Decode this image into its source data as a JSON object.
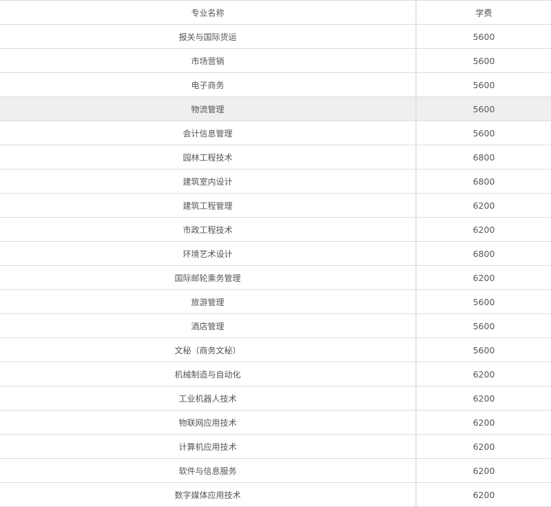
{
  "table": {
    "headers": {
      "major": "专业名称",
      "fee": "学费"
    },
    "highlighted_row": 3,
    "rows": [
      {
        "major": "报关与国际货运",
        "fee": "5600"
      },
      {
        "major": "市场营销",
        "fee": "5600"
      },
      {
        "major": "电子商务",
        "fee": "5600"
      },
      {
        "major": "物流管理",
        "fee": "5600"
      },
      {
        "major": "会计信息管理",
        "fee": "5600"
      },
      {
        "major": "园林工程技术",
        "fee": "6800"
      },
      {
        "major": "建筑室内设计",
        "fee": "6800"
      },
      {
        "major": "建筑工程管理",
        "fee": "6200"
      },
      {
        "major": "市政工程技术",
        "fee": "6200"
      },
      {
        "major": "环境艺术设计",
        "fee": "6800"
      },
      {
        "major": "国际邮轮乘务管理",
        "fee": "6200"
      },
      {
        "major": "旅游管理",
        "fee": "5600"
      },
      {
        "major": "酒店管理",
        "fee": "5600"
      },
      {
        "major": "文秘（商务文秘）",
        "fee": "5600"
      },
      {
        "major": "机械制造与自动化",
        "fee": "6200"
      },
      {
        "major": "工业机器人技术",
        "fee": "6200"
      },
      {
        "major": "物联网应用技术",
        "fee": "6200"
      },
      {
        "major": "计算机应用技术",
        "fee": "6200"
      },
      {
        "major": "软件与信息服务",
        "fee": "6200"
      },
      {
        "major": "数字媒体应用技术",
        "fee": "6200"
      }
    ]
  }
}
